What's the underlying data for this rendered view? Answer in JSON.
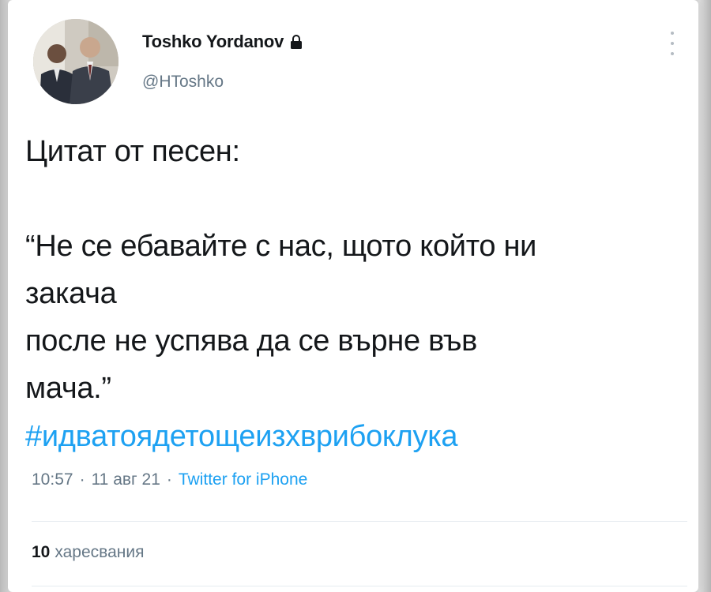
{
  "user": {
    "display_name": "Toshko Yordanov",
    "handle": "@HToshko"
  },
  "tweet": {
    "text": "Цитат от песен:\n\n“Не се ебавайте с нас, щото който ни\nзакача\nпосле не успява да се върне във\nмача.”",
    "hashtag": "#идватоядетощеизхврибоклука"
  },
  "meta": {
    "time": "10:57",
    "separator": "·",
    "date": "11 авг 21",
    "source": "Twitter for iPhone"
  },
  "stats": {
    "likes_count": "10",
    "likes_label": "харесвания"
  },
  "colors": {
    "accent": "#1da1f2",
    "text": "#14171a",
    "secondary": "#657786"
  },
  "icons": {
    "lock": "lock-icon",
    "more": "more-vertical-icon"
  }
}
